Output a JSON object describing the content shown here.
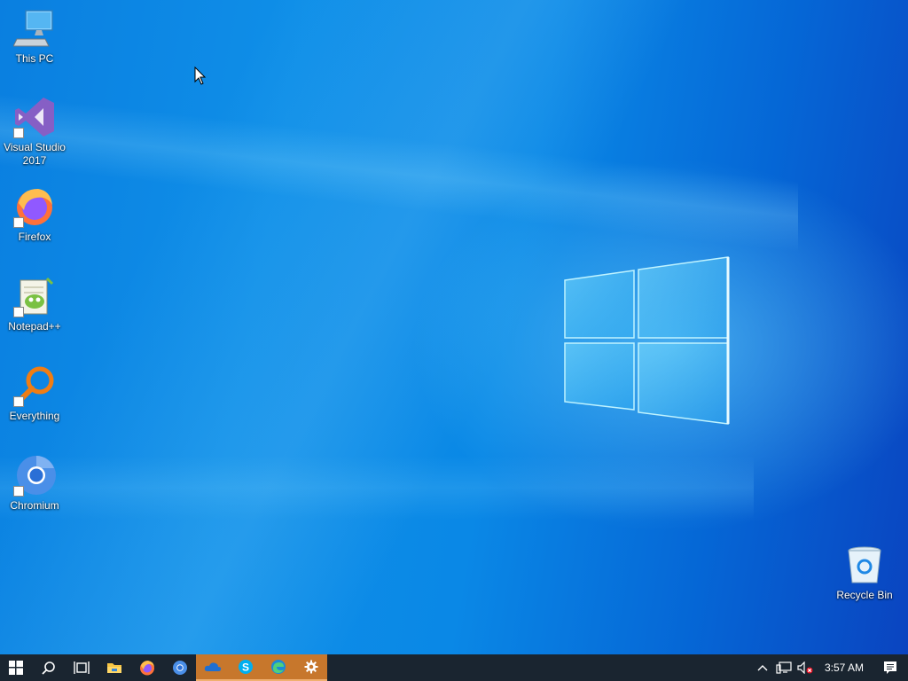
{
  "desktop": {
    "icons": [
      {
        "label": "This PC",
        "icon": "this-pc-icon"
      },
      {
        "label": "Visual Studio 2017",
        "icon": "visual-studio-icon"
      },
      {
        "label": "Firefox",
        "icon": "firefox-icon"
      },
      {
        "label": "Notepad++",
        "icon": "notepad-plus-plus-icon"
      },
      {
        "label": "Everything",
        "icon": "everything-search-icon"
      },
      {
        "label": "Chromium",
        "icon": "chromium-icon"
      },
      {
        "label": "Recycle Bin",
        "icon": "recycle-bin-icon"
      }
    ]
  },
  "taskbar": {
    "buttons": [
      {
        "name": "start",
        "icon": "windows-start-icon",
        "active": false
      },
      {
        "name": "search",
        "icon": "search-icon",
        "active": false
      },
      {
        "name": "task-view",
        "icon": "task-view-icon",
        "active": false
      },
      {
        "name": "file-explorer",
        "icon": "folder-icon",
        "active": false
      },
      {
        "name": "firefox",
        "icon": "firefox-icon",
        "active": false
      },
      {
        "name": "chromium",
        "icon": "chromium-icon",
        "active": false
      },
      {
        "name": "onedrive",
        "icon": "onedrive-icon",
        "active": true
      },
      {
        "name": "skype",
        "icon": "skype-icon",
        "active": true
      },
      {
        "name": "edge",
        "icon": "edge-icon",
        "active": true
      },
      {
        "name": "settings",
        "icon": "gear-icon",
        "active": true
      }
    ],
    "tray": {
      "clock": "3:57 AM",
      "icons": [
        "chevron-up-icon",
        "network-icon",
        "volume-muted-icon",
        "notification-icon"
      ]
    },
    "active_color": "#c7772c",
    "background_color": "#1a2530"
  }
}
